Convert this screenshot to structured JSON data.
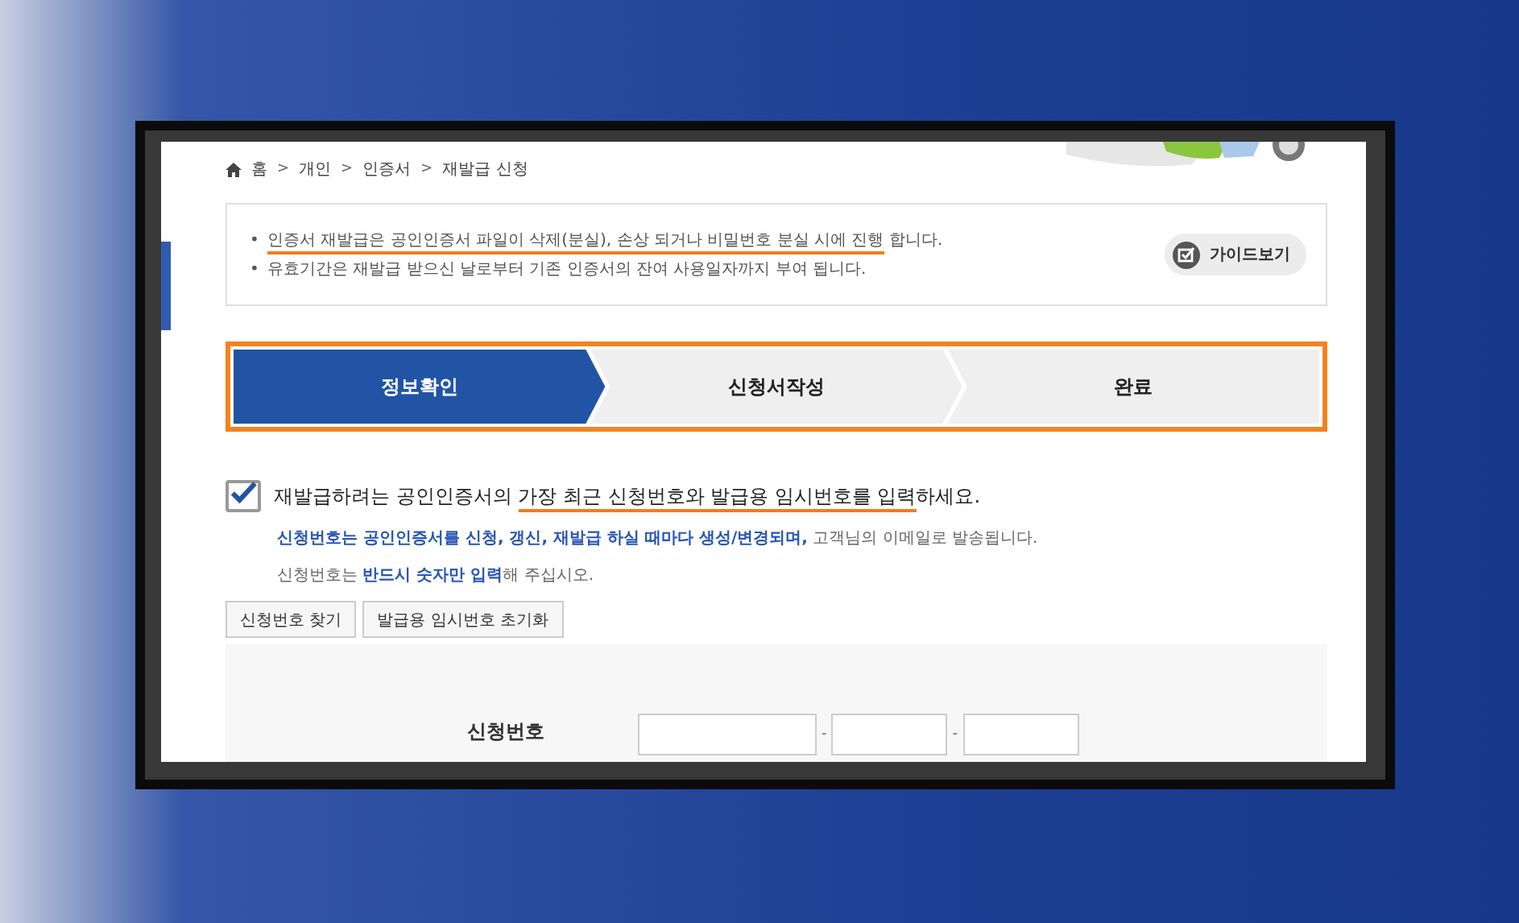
{
  "breadcrumb": {
    "separator": ">",
    "items": [
      "홈",
      "개인",
      "인증서",
      "재발급 신청"
    ]
  },
  "notice": {
    "lines": [
      {
        "bullet": "•",
        "segments": [
          {
            "text": "인증서 재발급은 공인인증서 파일이 삭제(분실), 손상 되거나 비밀번호 분실 시에 진행",
            "underlined": true
          },
          {
            "text": " 합니다.",
            "underlined": false
          }
        ]
      },
      {
        "bullet": "•",
        "segments": [
          {
            "text": "유효기간은 재발급 받으신 날로부터 기존 인증서의 잔여 사용일자까지 부여 됩니다.",
            "underlined": false
          }
        ]
      }
    ],
    "guide_button": "가이드보기"
  },
  "steps": [
    {
      "label": "정보확인",
      "selected": true
    },
    {
      "label": "신청서작성",
      "selected": false
    },
    {
      "label": "완료",
      "selected": false
    }
  ],
  "instructions": {
    "checked": true,
    "heading": [
      {
        "text": "재발급하려는 공인인증서의 ",
        "underlined": false
      },
      {
        "text": "가장 최근 신청번호와 발급용 임시번호를 입력",
        "underlined": true
      },
      {
        "text": "하세요.",
        "underlined": false
      }
    ],
    "lines": [
      [
        {
          "text": "신청번호는 공인인증서를 신청, 갱신, 재발급 하실 때마다 생성/변경되며,",
          "emphasis": true
        },
        {
          "text": " 고객님의 이메일로 발송됩니다.",
          "emphasis": false
        }
      ],
      [
        {
          "text": "신청번호는 ",
          "emphasis": false
        },
        {
          "text": "반드시 숫자만 입력",
          "emphasis": true
        },
        {
          "text": "해 주십시오.",
          "emphasis": false
        }
      ]
    ]
  },
  "buttons": [
    "신청번호 찾기",
    "발급용 임시번호 초기화"
  ],
  "form": {
    "label": "신청번호",
    "separator": "-"
  }
}
